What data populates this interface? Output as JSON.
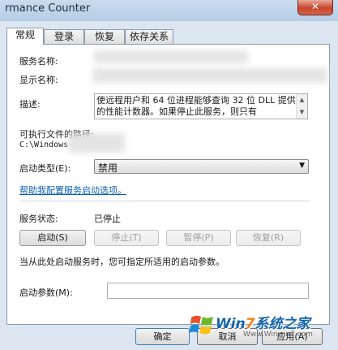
{
  "window": {
    "title": "rmance Counter",
    "close_label": "✕"
  },
  "tabs": [
    {
      "label": "常规",
      "active": true
    },
    {
      "label": "登录",
      "active": false
    },
    {
      "label": "恢复",
      "active": false
    },
    {
      "label": "依存关系",
      "active": false
    }
  ],
  "general": {
    "service_name_label": "服务名称:",
    "display_name_label": "显示名称:",
    "description_label": "描述:",
    "description_text": "使远程用户和 64 位进程能够查询 32 位 DLL 提供的性能计数器。如果停止此服务，则只有",
    "path_label": "可执行文件的路径:",
    "path_value": "C:\\Windows",
    "startup_type_label": "启动类型(E):",
    "startup_type_value": "禁用",
    "help_link": "帮助我配置服务启动选项。",
    "status_label": "服务状态:",
    "status_value": "已停止",
    "buttons": {
      "start": "启动(S)",
      "stop": "停止(T)",
      "pause": "暂停(P)",
      "resume": "恢复(R)"
    },
    "hint": "当从此处启动服务时，您可指定所适用的启动参数。",
    "params_label": "启动参数(M):",
    "params_value": ""
  },
  "footer": {
    "ok": "确定",
    "cancel": "取消",
    "apply": "应用(A)"
  },
  "watermark": {
    "brand_prefix": "Win",
    "brand_seven": "7",
    "brand_suffix": "系统之家",
    "url": "Www.Winwin7.com"
  },
  "colors": {
    "link": "#0b5fb3",
    "accent_orange": "#f07f1a",
    "accent_blue": "#1565a8"
  }
}
